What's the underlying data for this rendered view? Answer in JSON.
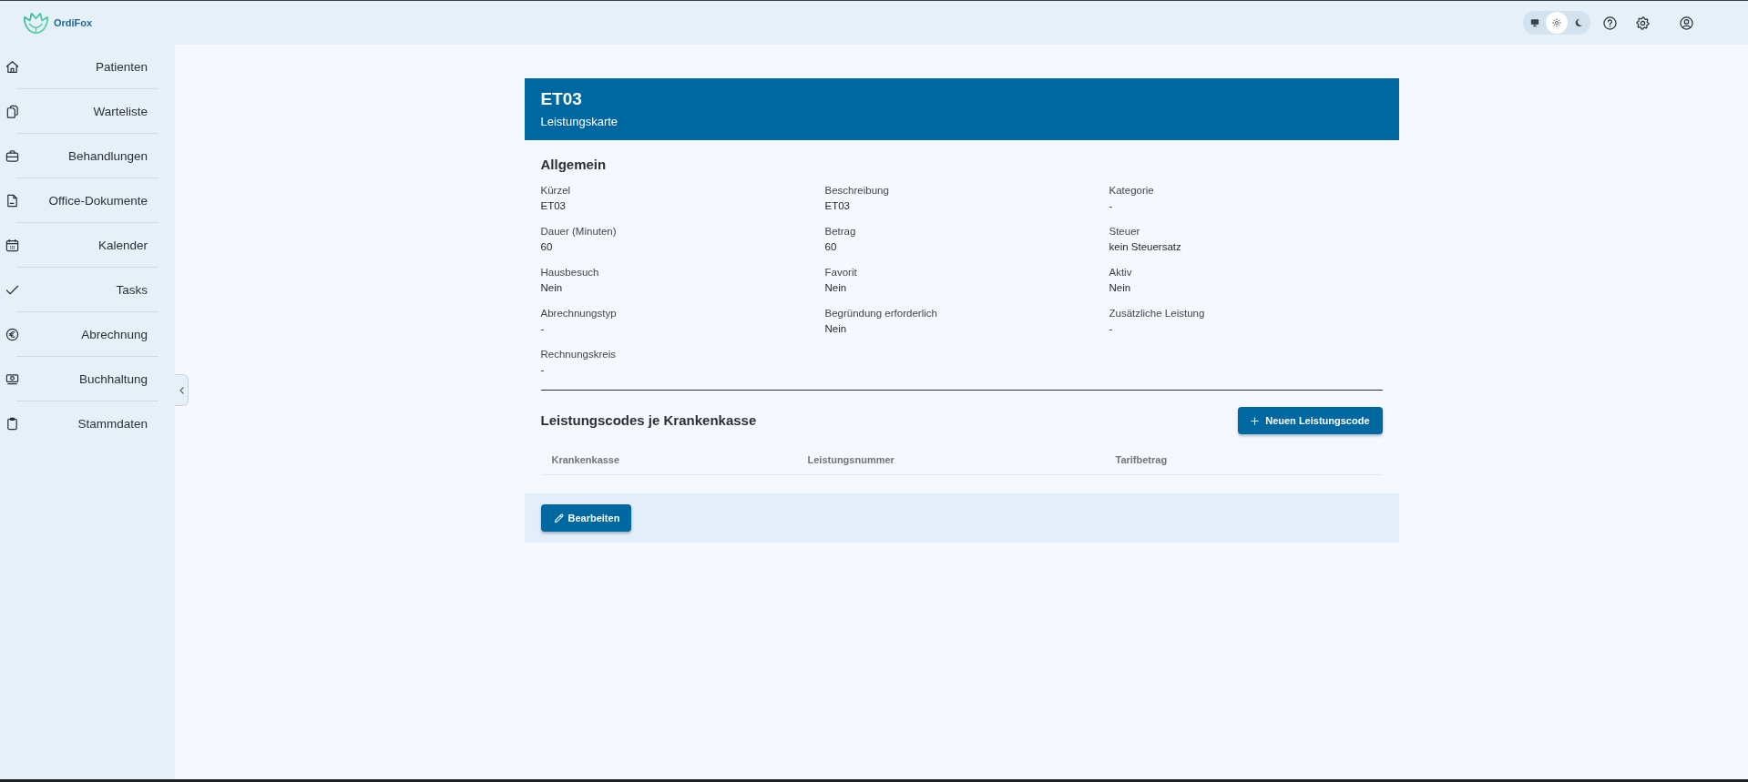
{
  "app": {
    "name": "OrdiFox"
  },
  "header": {
    "theme_modes": [
      {
        "kind": "monitor",
        "selected": false
      },
      {
        "kind": "sun",
        "selected": true
      },
      {
        "kind": "moon",
        "selected": false
      }
    ]
  },
  "sidebar": {
    "items": [
      {
        "label": "Patienten",
        "selected": false
      },
      {
        "label": "Warteliste",
        "selected": false
      },
      {
        "label": "Behandlungen",
        "selected": false
      },
      {
        "label": "Office-Dokumente",
        "selected": false
      },
      {
        "label": "Kalender",
        "selected": false
      },
      {
        "label": "Tasks",
        "selected": false
      },
      {
        "label": "Abrechnung",
        "selected": false
      },
      {
        "label": "Buchhaltung",
        "selected": false
      },
      {
        "label": "Stammdaten",
        "selected": false
      }
    ]
  },
  "card": {
    "title": "ET03",
    "subtitle": "Leistungskarte"
  },
  "general": {
    "heading": "Allgemein",
    "fields": [
      {
        "label": "Kürzel",
        "value": "ET03"
      },
      {
        "label": "Beschreibung",
        "value": "ET03"
      },
      {
        "label": "Kategorie",
        "value": "-"
      },
      {
        "label": "Dauer (Minuten)",
        "value": "60"
      },
      {
        "label": "Betrag",
        "value": "60"
      },
      {
        "label": "Steuer",
        "value": "kein Steuersatz"
      },
      {
        "label": "Hausbesuch",
        "value": "Nein"
      },
      {
        "label": "Favorit",
        "value": "Nein"
      },
      {
        "label": "Aktiv",
        "value": "Nein"
      },
      {
        "label": "Abrechnungstyp",
        "value": "-"
      },
      {
        "label": "Begründung erforderlich",
        "value": "Nein"
      },
      {
        "label": "Zusätzliche Leistung",
        "value": "-"
      },
      {
        "label": "Rechnungskreis",
        "value": "-"
      }
    ]
  },
  "codes": {
    "heading": "Leistungscodes je Krankenkasse",
    "add_button": "Neuen Leistungscode",
    "table": {
      "columns": [
        "Krankenkasse",
        "Leistungsnummer",
        "Tarifbetrag"
      ]
    }
  },
  "footer": {
    "edit_button": "Bearbeiten"
  }
}
